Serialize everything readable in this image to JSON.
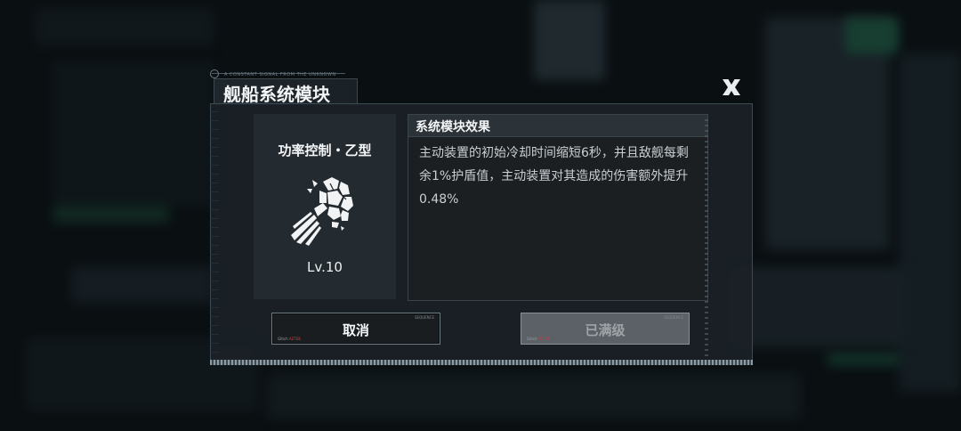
{
  "dialog": {
    "title": "舰船系统模块",
    "title_tag": "A CONSTANT SIGNAL FROM THE UNKNOWN"
  },
  "module": {
    "name": "功率控制・乙型",
    "level": "Lv.10",
    "icon": "burst-shot-icon"
  },
  "effect": {
    "header": "系统模块效果",
    "description": "主动装置的初始冷却时间缩短6秒，并且敌舰每剩余1%护盾值，主动装置对其造成的伤害额外提升0.48%"
  },
  "buttons": {
    "cancel": {
      "label": "取消",
      "tiny_top": "SEQUENCE",
      "tiny_bottom_a": "Glitch",
      "tiny_bottom_b": "AZTEK"
    },
    "maxed": {
      "label": "已满级",
      "tiny_top": "SEQUENCE",
      "tiny_bottom_a": "Glitch",
      "tiny_bottom_b": "AZTEK"
    }
  },
  "colors": {
    "panel": "#1b2126",
    "accent_red": "#d04040",
    "disabled_button": "#5b6166"
  }
}
